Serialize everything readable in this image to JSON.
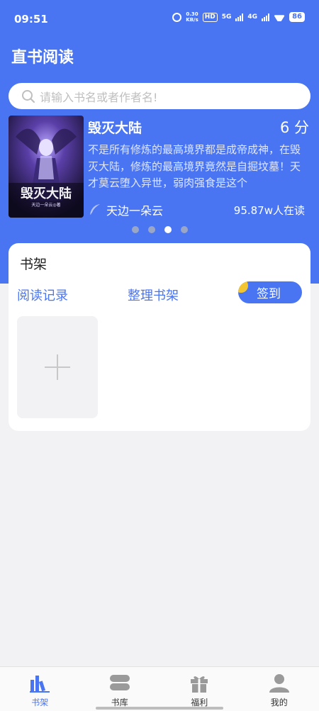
{
  "status_bar": {
    "time": "09:51",
    "net_speed": "0.30\nKB/s",
    "hd": "HD",
    "net1": "5G",
    "net2": "4G",
    "battery": "86"
  },
  "header": {
    "title": "直书阅读"
  },
  "search": {
    "placeholder": "请输入书名或者作者名!",
    "icon": "search-icon"
  },
  "featured": {
    "title": "毁灭大陆",
    "score": "6 分",
    "description": "不是所有修炼的最高境界都是成帝成神，在毁灭大陆，修炼的最高境界竟然是自掘坟墓！天才莫云堕入异世，弱肉强食是这个",
    "author": "天边一朵云",
    "readers": "95.87w人在读",
    "cover_title": "毁灭大陆",
    "cover_author": "天边一朵云◎著",
    "carousel_total": 4,
    "carousel_active": 3
  },
  "bookshelf": {
    "title": "书架",
    "reading_history": "阅读记录",
    "organize": "整理书架",
    "sign_in": "签到"
  },
  "tabbar": {
    "items": [
      {
        "label": "书架",
        "icon": "bookshelf-icon",
        "active": true
      },
      {
        "label": "书库",
        "icon": "library-icon",
        "active": false
      },
      {
        "label": "福利",
        "icon": "gift-icon",
        "active": false
      },
      {
        "label": "我的",
        "icon": "profile-icon",
        "active": false
      }
    ]
  },
  "colors": {
    "accent": "#4a75f2",
    "coin": "#f3c531",
    "background": "#f2f2f4"
  }
}
